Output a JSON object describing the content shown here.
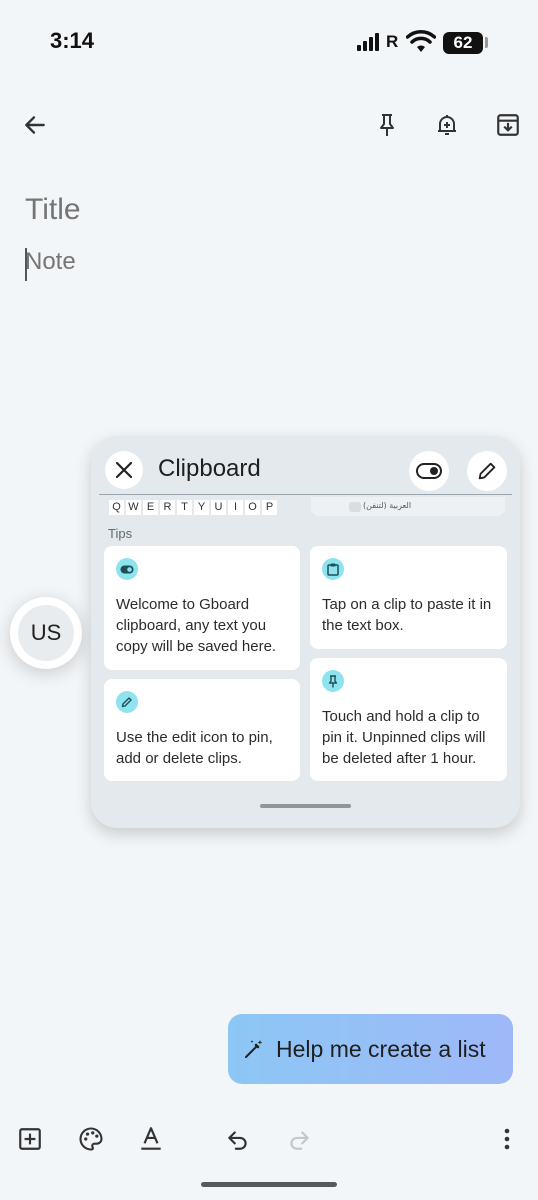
{
  "status_bar": {
    "time": "3:14",
    "network_label": "R",
    "battery_level": "62"
  },
  "app_bar": {
    "back_icon": "arrow-left-icon",
    "pin_icon": "pin-icon",
    "reminder_icon": "bell-plus-icon",
    "archive_icon": "archive-icon"
  },
  "editor": {
    "title_placeholder": "Title",
    "note_placeholder": "Note"
  },
  "floating_bubble": {
    "label": "US"
  },
  "clipboard": {
    "title": "Clipboard",
    "keyboard_preview_keys": [
      "Q",
      "W",
      "E",
      "R",
      "T",
      "Y",
      "U",
      "I",
      "O",
      "P"
    ],
    "language_preview": "العربية (لتنفن)",
    "tips_label": "Tips",
    "tips": [
      {
        "icon": "toggle-icon",
        "text": "Welcome to Gboard clipboard, any text you copy will be saved here."
      },
      {
        "icon": "clipboard-icon",
        "text": "Tap on a clip to paste it in the text box."
      },
      {
        "icon": "pencil-icon",
        "text": "Use the edit icon to pin, add or delete clips."
      },
      {
        "icon": "pin-icon",
        "text": "Touch and hold a clip to pin it. Unpinned clips will be deleted after 1 hour."
      }
    ]
  },
  "assist": {
    "label": "Help me create a list"
  },
  "bottom_toolbar": {
    "icons": [
      "add-box-icon",
      "palette-icon",
      "text-format-icon",
      "undo-icon",
      "redo-icon",
      "more-vert-icon"
    ]
  },
  "colors": {
    "background": "#f3f6f8",
    "panel": "#e3e9ec",
    "tip_icon_bg": "#8ee3ef",
    "assist_gradient_start": "#8cc7f5",
    "assist_gradient_end": "#9fb8f8"
  }
}
